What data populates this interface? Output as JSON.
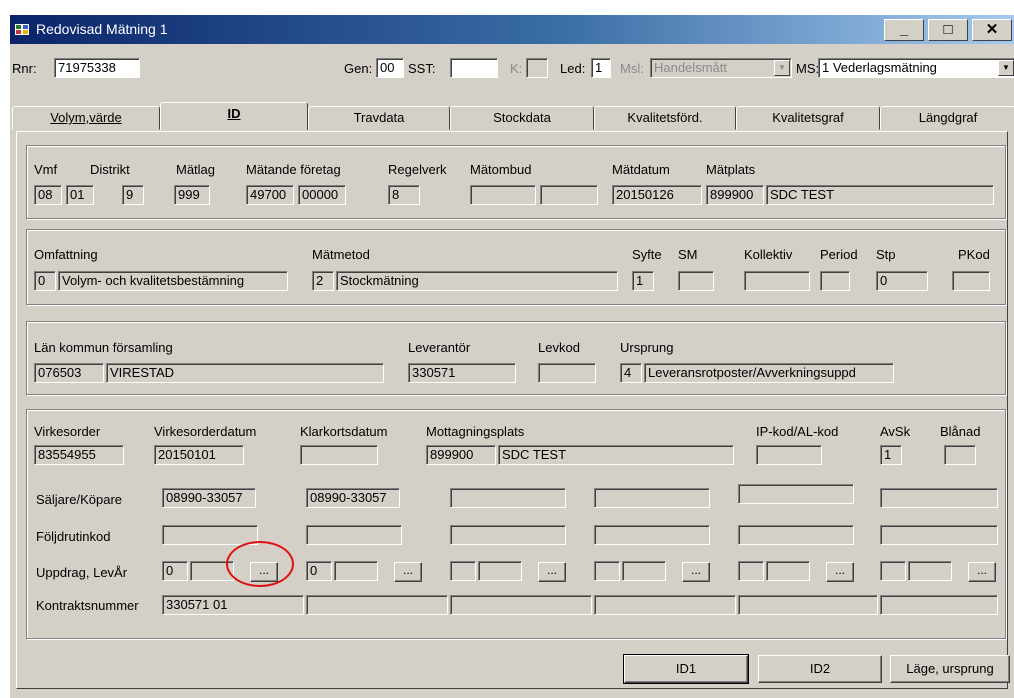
{
  "window": {
    "title": "Redovisad Mätning 1",
    "minimize": "_",
    "maximize": "□",
    "close": "✕"
  },
  "header": {
    "rnr_label": "Rnr:",
    "rnr_value": "71975338",
    "gen_label": "Gen:",
    "gen_value": "00",
    "sst_label": "SST:",
    "sst_value": "",
    "k_label": "K:",
    "k_value": "",
    "led_label": "Led:",
    "led_value": "1",
    "msl_label": "Msl:",
    "msl_value": "Handelsmått",
    "ms_label": "MS:",
    "ms_value": "1 Vederlagsmätning"
  },
  "tabs": [
    {
      "label": "Volym,värde",
      "active": false
    },
    {
      "label": "ID",
      "active": true
    },
    {
      "label": "Travdata",
      "active": false
    },
    {
      "label": "Stockdata",
      "active": false
    },
    {
      "label": "Kvalitetsförd.",
      "active": false
    },
    {
      "label": "Kvalitetsgraf",
      "active": false
    },
    {
      "label": "Längdgraf",
      "active": false
    }
  ],
  "group1": {
    "labels": {
      "vmf": "Vmf",
      "distrikt": "Distrikt",
      "matlag": "Mätlag",
      "matande": "Mätande företag",
      "regelverk": "Regelverk",
      "matombud": "Mätombud",
      "matdatum": "Mätdatum",
      "matplats": "Mätplats"
    },
    "values": {
      "vmf": "08",
      "vmf2": "01",
      "distrikt": "9",
      "matlag": "999",
      "matande1": "49700",
      "matande2": "00000",
      "regelverk": "8",
      "matombud1": "",
      "matombud2": "",
      "matdatum": "20150126",
      "matplats_code": "899900",
      "matplats_name": "SDC TEST"
    }
  },
  "group2": {
    "labels": {
      "omfattning": "Omfattning",
      "matmetod": "Mätmetod",
      "syfte": "Syfte",
      "sm": "SM",
      "kollektiv": "Kollektiv",
      "period": "Period",
      "stp": "Stp",
      "pkod": "PKod"
    },
    "values": {
      "omfattning_code": "0",
      "omfattning_text": "Volym- och kvalitetsbestämning",
      "matmetod_code": "2",
      "matmetod_text": "Stockmätning",
      "syfte": "1",
      "sm": "",
      "kollektiv": "",
      "period": "",
      "stp": "0",
      "pkod": ""
    }
  },
  "group3": {
    "labels": {
      "lan": "Län kommun församling",
      "leverantor": "Leverantör",
      "levkod": "Levkod",
      "ursprung": "Ursprung"
    },
    "values": {
      "lan_code": "076503",
      "lan_name": "VIRESTAD",
      "leverantor": "330571",
      "levkod": "",
      "ursprung_code": "4",
      "ursprung_text": "Leveransrotposter/Avverkningsuppd"
    }
  },
  "group4": {
    "labels": {
      "virkesorder": "Virkesorder",
      "virkesorderdatum": "Virkesorderdatum",
      "klarkortsdatum": "Klarkortsdatum",
      "mottagningsplats": "Mottagningsplats",
      "ipkod": "IP-kod/AL-kod",
      "avsk": "AvSk",
      "blanad": "Blånad",
      "saljare": "Säljare/Köpare",
      "foljdrutinkod": "Följdrutinkod",
      "uppdrag": "Uppdrag, LevÅr",
      "kontraktsnummer": "Kontraktsnummer"
    },
    "values": {
      "virkesorder": "83554955",
      "virkesorderdatum": "20150101",
      "klarkortsdatum": "",
      "mottagning_code": "899900",
      "mottagning_name": "SDC TEST",
      "ipkod": "",
      "avsk": "1",
      "blanad": "",
      "saljare": [
        "08990-33057",
        "08990-33057",
        "",
        "",
        "",
        ""
      ],
      "uppdrag1": "0",
      "uppdrag2": "0",
      "kontrakt": "330571 01"
    },
    "ellipsis": "..."
  },
  "buttons": {
    "id1": "ID1",
    "id2": "ID2",
    "lage": "Läge, ursprung"
  }
}
